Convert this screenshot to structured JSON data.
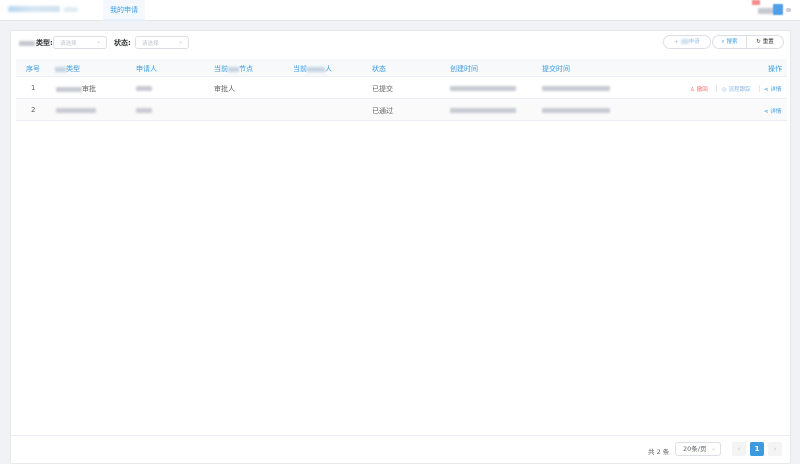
{
  "header": {
    "tab_label": "我的申请"
  },
  "filters": {
    "type_label_suffix": "类型:",
    "type_placeholder": "请选择",
    "status_label": "状态:",
    "status_placeholder": "请选择"
  },
  "actions": {
    "add_label": "申请",
    "search_label": "搜索",
    "reset_label": "重置"
  },
  "table": {
    "columns": {
      "index": "序号",
      "type_suffix": "类型",
      "applicant": "申请人",
      "current_node_prefix": "当前",
      "current_node_suffix": "节点",
      "current_handler_prefix": "当前",
      "current_handler_suffix": "人",
      "status": "状态",
      "created": "创建时间",
      "submitted": "提交时间",
      "operations": "操作"
    },
    "rows": [
      {
        "index": "1",
        "type_suffix": "审批",
        "current_node": "审批人",
        "status": "已提交",
        "actions": {
          "revoke": "撤回",
          "track": "流程跟踪",
          "detail": "详情"
        }
      },
      {
        "index": "2",
        "type_suffix": "",
        "current_node": "",
        "status": "已通过",
        "actions": {
          "detail": "详情"
        }
      }
    ]
  },
  "pagination": {
    "total": "共 2 条",
    "page_size": "20条/页",
    "current_page": "1",
    "prev": "‹",
    "next": "›"
  },
  "colors": {
    "accent": "#3a9be0",
    "danger": "#f56c6c"
  }
}
